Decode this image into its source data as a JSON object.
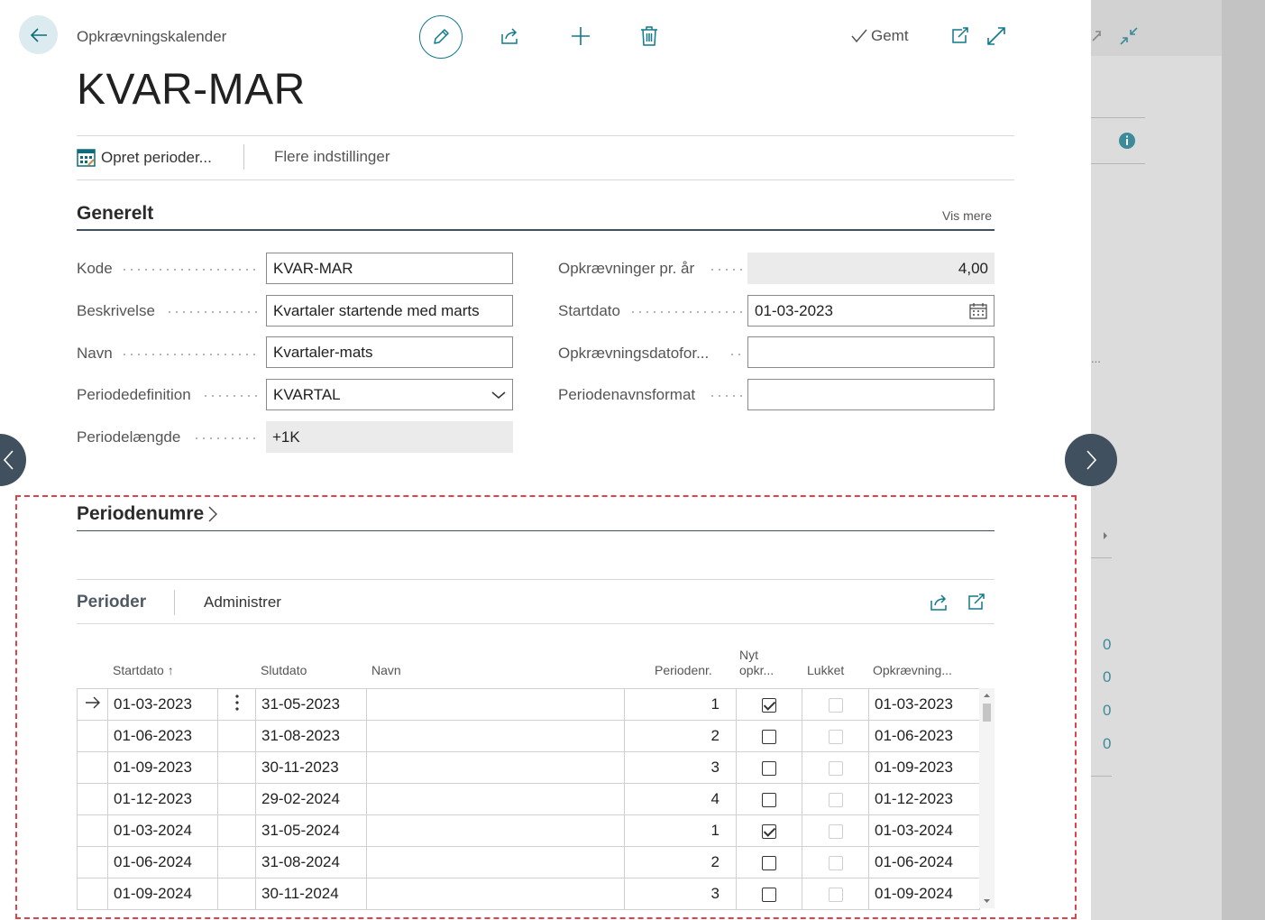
{
  "header": {
    "breadcrumb": "Opkrævningskalender",
    "saved_label": "Gemt",
    "title": "KVAR-MAR"
  },
  "actions": {
    "create_periods": "Opret perioder...",
    "more_settings": "Flere indstillinger"
  },
  "general": {
    "heading": "Generelt",
    "show_more": "Vis mere",
    "fields": {
      "kode": {
        "label": "Kode",
        "value": "KVAR-MAR"
      },
      "beskrivelse": {
        "label": "Beskrivelse",
        "value": "Kvartaler startende med marts"
      },
      "navn": {
        "label": "Navn",
        "value": "Kvartaler-mats"
      },
      "periodedefinition": {
        "label": "Periodedefinition",
        "value": "KVARTAL"
      },
      "periodelaengde": {
        "label": "Periodelængde",
        "value": "+1K"
      },
      "opkr_pr_aar": {
        "label": "Opkrævninger pr. år",
        "value": "4,00"
      },
      "startdato": {
        "label": "Startdato",
        "value": "01-03-2023"
      },
      "opkr_datoformat": {
        "label": "Opkrævningsdatofor...",
        "value": ""
      },
      "periodenavnsformat": {
        "label": "Periodenavnsformat",
        "value": ""
      }
    }
  },
  "periodenumre": {
    "heading": "Periodenumre",
    "tabs": {
      "perioder": "Perioder",
      "administrer": "Administrer"
    },
    "columns": {
      "startdato": "Startdato ↑",
      "slutdato": "Slutdato",
      "navn": "Navn",
      "periodenr": "Periodenr.",
      "nyt_opkr_1": "Nyt",
      "nyt_opkr_2": "opkr...",
      "lukket": "Lukket",
      "opkraevning": "Opkrævning..."
    },
    "rows": [
      {
        "start": "01-03-2023",
        "slut": "31-05-2023",
        "navn": "",
        "nr": "1",
        "nyt": true,
        "lukket": false,
        "opk": "01-03-2023"
      },
      {
        "start": "01-06-2023",
        "slut": "31-08-2023",
        "navn": "",
        "nr": "2",
        "nyt": false,
        "lukket": false,
        "opk": "01-06-2023"
      },
      {
        "start": "01-09-2023",
        "slut": "30-11-2023",
        "navn": "",
        "nr": "3",
        "nyt": false,
        "lukket": false,
        "opk": "01-09-2023"
      },
      {
        "start": "01-12-2023",
        "slut": "29-02-2024",
        "navn": "",
        "nr": "4",
        "nyt": false,
        "lukket": false,
        "opk": "01-12-2023"
      },
      {
        "start": "01-03-2024",
        "slut": "31-05-2024",
        "navn": "",
        "nr": "1",
        "nyt": true,
        "lukket": false,
        "opk": "01-03-2024"
      },
      {
        "start": "01-06-2024",
        "slut": "31-08-2024",
        "navn": "",
        "nr": "2",
        "nyt": false,
        "lukket": false,
        "opk": "01-06-2024"
      },
      {
        "start": "01-09-2024",
        "slut": "30-11-2024",
        "navn": "",
        "nr": "3",
        "nyt": false,
        "lukket": false,
        "opk": "01-09-2024"
      }
    ]
  },
  "background": {
    "truncated": "...",
    "zeros": [
      "0",
      "0",
      "0",
      "0"
    ]
  },
  "colors": {
    "accent": "#0e7a8a",
    "highlight_border": "#e0424b",
    "nav_circle": "#41505f"
  }
}
